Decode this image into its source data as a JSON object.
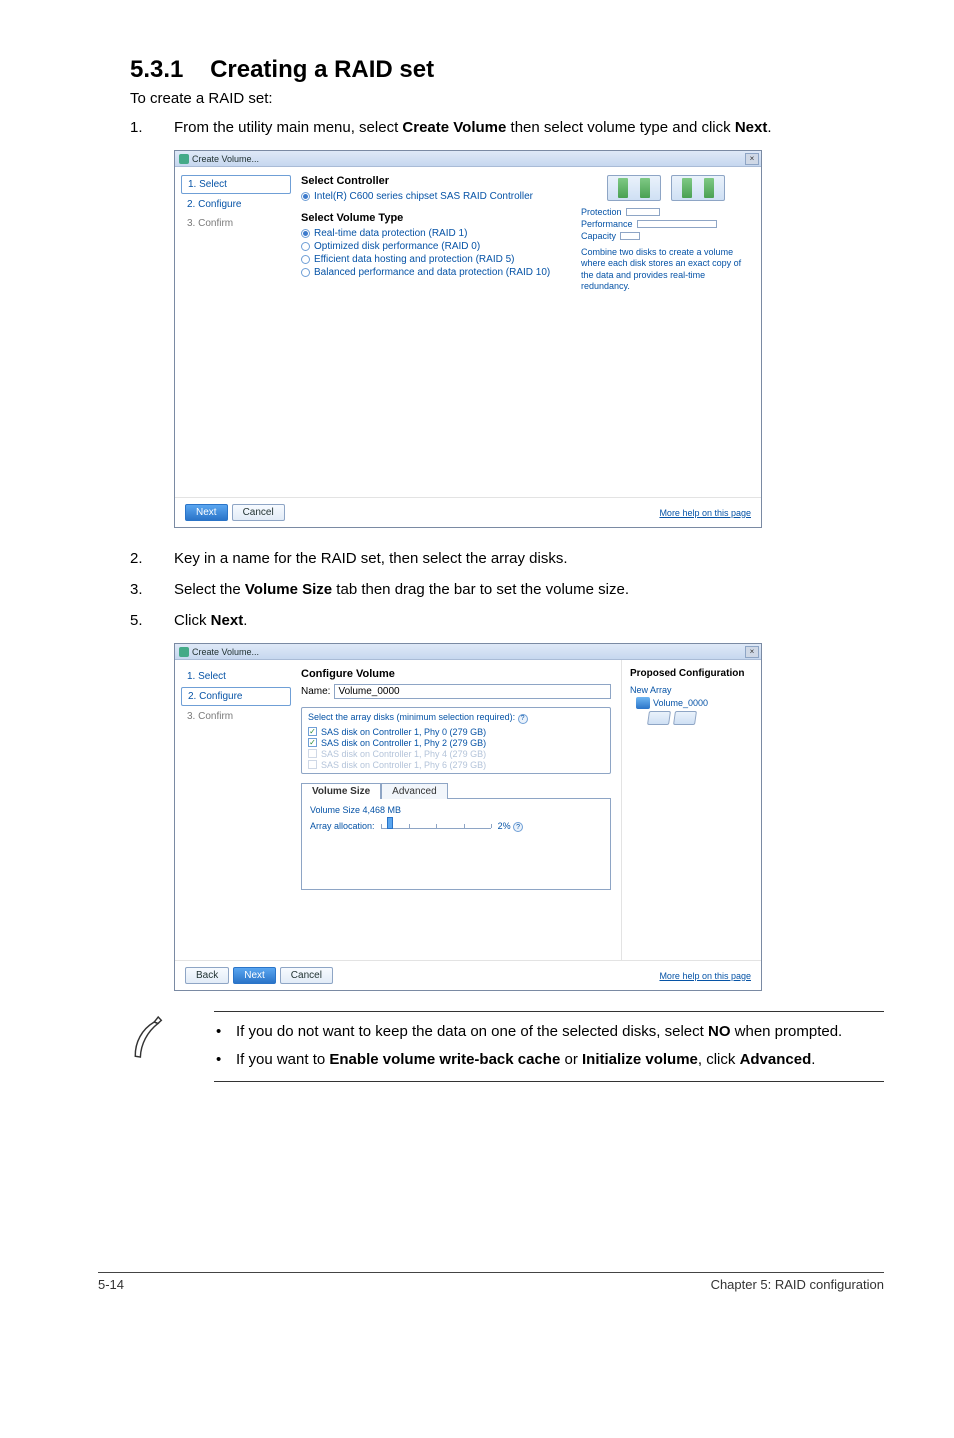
{
  "heading": {
    "number": "5.3.1",
    "title": "Creating a RAID set"
  },
  "intro": "To create a RAID set:",
  "steps": [
    {
      "num": "1.",
      "html": "From the utility main menu, select <b>Create Volume</b> then select volume type and click <b>Next</b>."
    },
    {
      "num": "2.",
      "html": "Key in a name for the RAID set, then select the array disks."
    },
    {
      "num": "3.",
      "html": "Select the <b>Volume Size</b> tab then drag the bar to set the volume size."
    },
    {
      "num": "5.",
      "html": "Click <b>Next</b>."
    }
  ],
  "win1": {
    "title": "Create Volume...",
    "close": "×",
    "nav": {
      "s1": "1. Select",
      "s2": "2. Configure",
      "s3": "3. Confirm"
    },
    "selectController": "Select Controller",
    "controller": "Intel(R) C600 series chipset SAS RAID Controller",
    "selectVolumeType": "Select Volume Type",
    "vt": {
      "r1": "Real-time data protection (RAID 1)",
      "r0": "Optimized disk performance (RAID 0)",
      "r5": "Efficient data hosting and protection (RAID 5)",
      "r10": "Balanced performance and data protection (RAID 10)"
    },
    "metrics": {
      "protection": "Protection",
      "performance": "Performance",
      "capacity": "Capacity"
    },
    "desc": "Combine two disks to create a volume where each disk stores an exact copy of the data and provides real-time redundancy.",
    "buttons": {
      "next": "Next",
      "cancel": "Cancel"
    },
    "helplink": "More help on this page"
  },
  "win2": {
    "title": "Create Volume...",
    "close": "×",
    "nav": {
      "s1": "1. Select",
      "s2": "2. Configure",
      "s3": "3. Confirm"
    },
    "heading": "Configure Volume",
    "nameLabel": "Name:",
    "nameValue": "Volume_0000",
    "selectCaption": "Select the array disks (minimum selection required):",
    "disks": {
      "d0": "SAS disk on Controller 1, Phy 0 (279 GB)",
      "d2": "SAS disk on Controller 1, Phy 2 (279 GB)",
      "d4": "SAS disk on Controller 1, Phy 4 (279 GB)",
      "d6": "SAS disk on Controller 1, Phy 6 (279 GB)"
    },
    "tabs": {
      "size": "Volume Size",
      "adv": "Advanced"
    },
    "volSize": "Volume Size 4,468 MB",
    "allocLabel": "Array allocation:",
    "allocPct": "2%",
    "proposed": "Proposed Configuration",
    "newArray": "New Array",
    "volName": "Volume_0000",
    "buttons": {
      "back": "Back",
      "next": "Next",
      "cancel": "Cancel"
    },
    "helplink": "More help on this page"
  },
  "notes": [
    "If you do not want to keep the data on one of the selected disks, select <b>NO</b> when prompted.",
    "If you want to <b>Enable volume write-back cache</b> or <b>Initialize volume</b>, click <b>Advanced</b>."
  ],
  "footer": {
    "page": "5-14",
    "chapter": "Chapter 5: RAID configuration"
  }
}
